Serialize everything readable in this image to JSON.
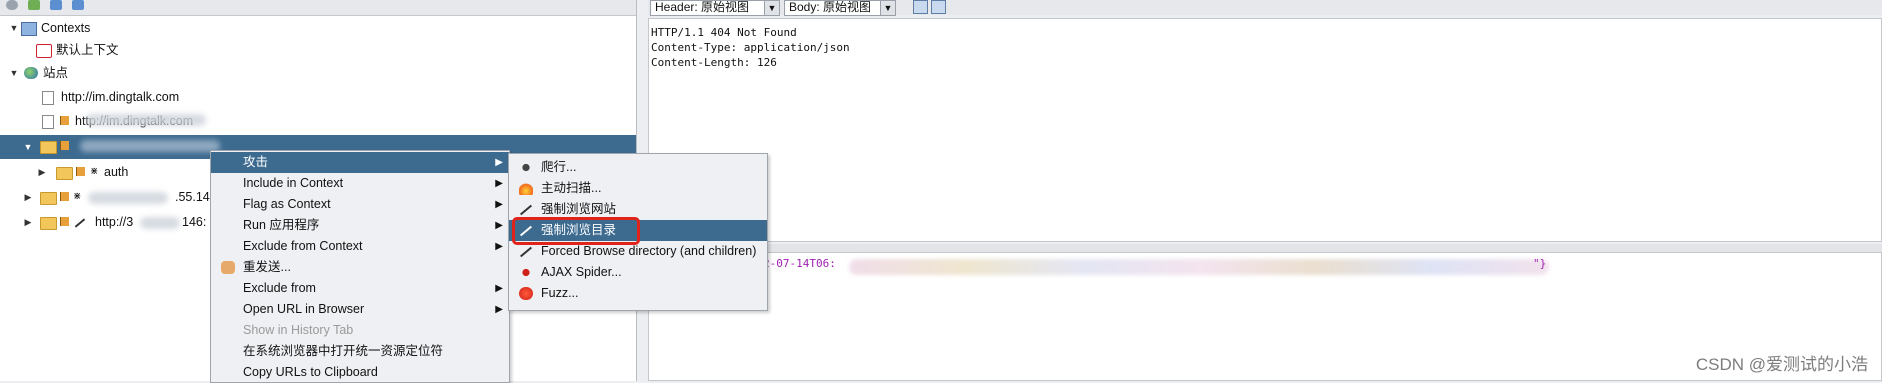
{
  "tree": {
    "contexts": "Contexts",
    "default_context": "默认上下文",
    "sites": "站点",
    "site1": "http://im.dingtalk.com",
    "site2": "http://im.dingtalk.com",
    "auth": "auth",
    "site4_suffix": ".55.14",
    "site5_prefix": "http://3",
    "site5_suffix": "146:"
  },
  "toolbar": {
    "header_view": "Header: 原始视图",
    "body_view": "Body: 原始视图"
  },
  "response": {
    "header_lines": [
      "HTTP/1.1 404 Not Found",
      "Content-Type: application/json",
      "Content-Length: 126"
    ],
    "body_start": "2-07-14T06:",
    "body_end": "\"}"
  },
  "context_menu": {
    "items": [
      "攻击",
      "Include in Context",
      "Flag as Context",
      "Run 应用程序",
      "Exclude from Context",
      "重发送...",
      "Exclude from",
      "Open URL in Browser",
      "Show in History Tab",
      "在系统浏览器中打开统一资源定位符",
      "Copy URLs to Clipboard"
    ]
  },
  "attack_menu": {
    "items": [
      "爬行...",
      "主动扫描...",
      "强制浏览网站",
      "强制浏览目录",
      "Forced Browse directory (and children)",
      "AJAX Spider...",
      "Fuzz..."
    ]
  },
  "watermark": "CSDN @爱测试的小浩",
  "colors": {
    "selection": "#3d6a8f",
    "highlight_box": "#e0241a",
    "body_text": "#a01eb3"
  },
  "icons": [
    "contexts-icon",
    "context-target-icon",
    "globe-icon",
    "page-icon",
    "folder-icon",
    "flag-icon",
    "spider-icon",
    "flame-icon",
    "wand-icon",
    "fuzz-icon"
  ]
}
